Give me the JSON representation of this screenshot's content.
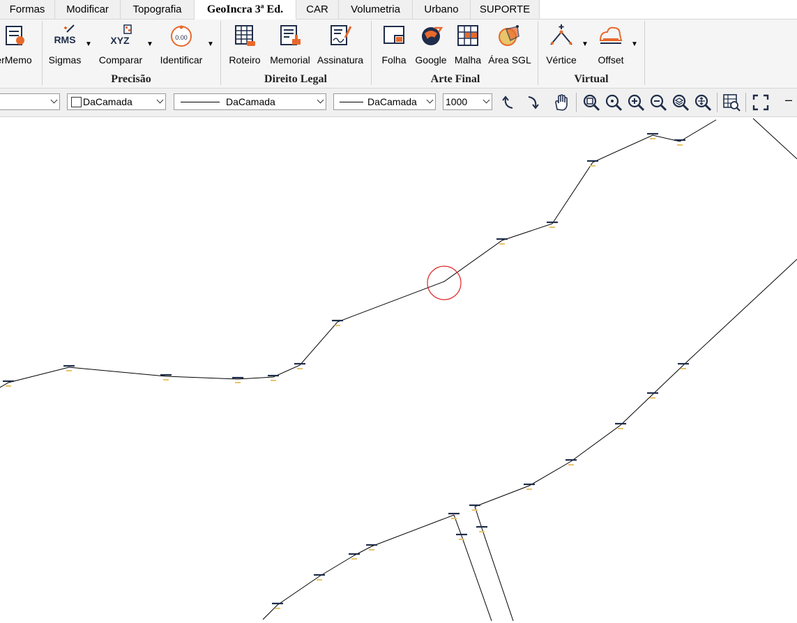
{
  "tabs": [
    {
      "label": "Formas"
    },
    {
      "label": "Modificar"
    },
    {
      "label": "Topografia"
    },
    {
      "label": "GeoIncra 3ª Ed."
    },
    {
      "label": "CAR"
    },
    {
      "label": "Volumetria"
    },
    {
      "label": "Urbano"
    },
    {
      "label": "SUPORTE"
    }
  ],
  "ribbon": {
    "buttons": {
      "supermemo": "erMemo",
      "sigmas": "Sigmas",
      "comparar": "Comparar",
      "identificar": "Identificar",
      "roteiro": "Roteiro",
      "memorial": "Memorial",
      "assinatura": "Assinatura",
      "folha": "Folha",
      "google": "Google",
      "malha": "Malha",
      "area_sgl": "Área SGL",
      "vertice": "Vértice",
      "offset": "Offset"
    },
    "icon_text": {
      "rms": "RMS",
      "xyz": "XYZ",
      "zero": "0.00"
    },
    "groups": {
      "precisao": "Precisão",
      "direito_legal": "Direito Legal",
      "arte_final": "Arte Final",
      "virtual": "Virtual"
    }
  },
  "toolbar": {
    "color_combo": "DaCamada",
    "linetype_combo": "DaCamada",
    "lineweight_combo": "DaCamada",
    "scale_combo": "1000",
    "minimize": "–"
  },
  "colors": {
    "accent_orange": "#e8692c",
    "icon_navy": "#1f2d4a",
    "marker_yellow": "#e8c46a",
    "cursor_red": "#e02020"
  }
}
